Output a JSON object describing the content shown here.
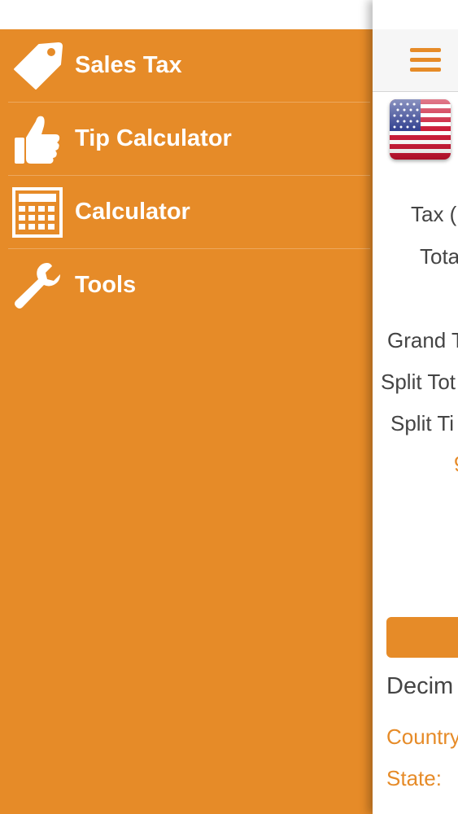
{
  "drawer": {
    "items": [
      {
        "label": "Sales Tax",
        "icon": "tag-icon"
      },
      {
        "label": "Tip Calculator",
        "icon": "thumbs-up-icon"
      },
      {
        "label": "Calculator",
        "icon": "calculator-icon"
      },
      {
        "label": "Tools",
        "icon": "wrench-icon"
      }
    ]
  },
  "main": {
    "labels": {
      "tax": "Tax (",
      "total": "Tota",
      "grand_total": "Grand T",
      "split_total": "Split Tot",
      "split_tip": "Split Ti",
      "orange_partial": "9",
      "decimal": "Decim",
      "country": "Country",
      "state": "State:"
    }
  },
  "colors": {
    "accent": "#e68b28",
    "text": "#444444",
    "white": "#ffffff"
  }
}
